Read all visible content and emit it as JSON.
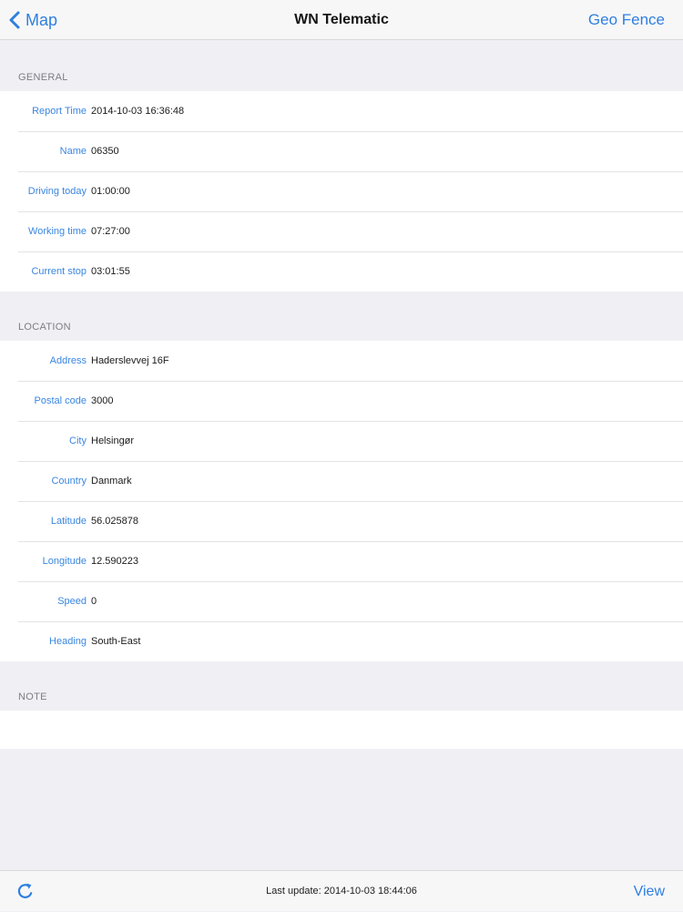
{
  "navbar": {
    "back_label": "Map",
    "title": "WN Telematic",
    "right_label": "Geo Fence"
  },
  "general": {
    "header": "GENERAL",
    "rows": [
      {
        "label": "Report Time",
        "value": "2014-10-03 16:36:48"
      },
      {
        "label": "Name",
        "value": "06350"
      },
      {
        "label": "Driving today",
        "value": "01:00:00"
      },
      {
        "label": "Working time",
        "value": "07:27:00"
      },
      {
        "label": "Current stop",
        "value": "03:01:55"
      }
    ]
  },
  "location": {
    "header": "LOCATION",
    "rows": [
      {
        "label": "Address",
        "value": "Haderslevvej 16F"
      },
      {
        "label": "Postal code",
        "value": "3000"
      },
      {
        "label": "City",
        "value": "Helsingør"
      },
      {
        "label": "Country",
        "value": "Danmark"
      },
      {
        "label": "Latitude",
        "value": "56.025878"
      },
      {
        "label": "Longitude",
        "value": "12.590223"
      },
      {
        "label": "Speed",
        "value": "0"
      },
      {
        "label": "Heading",
        "value": "South-East"
      }
    ]
  },
  "note": {
    "header": "NOTE",
    "value": ""
  },
  "toolbar": {
    "refresh_icon": "refresh-icon",
    "status": "Last update: 2014-10-03 18:44:06",
    "view_label": "View"
  },
  "colors": {
    "accent": "#2f7fe0",
    "background": "#efeff4"
  }
}
